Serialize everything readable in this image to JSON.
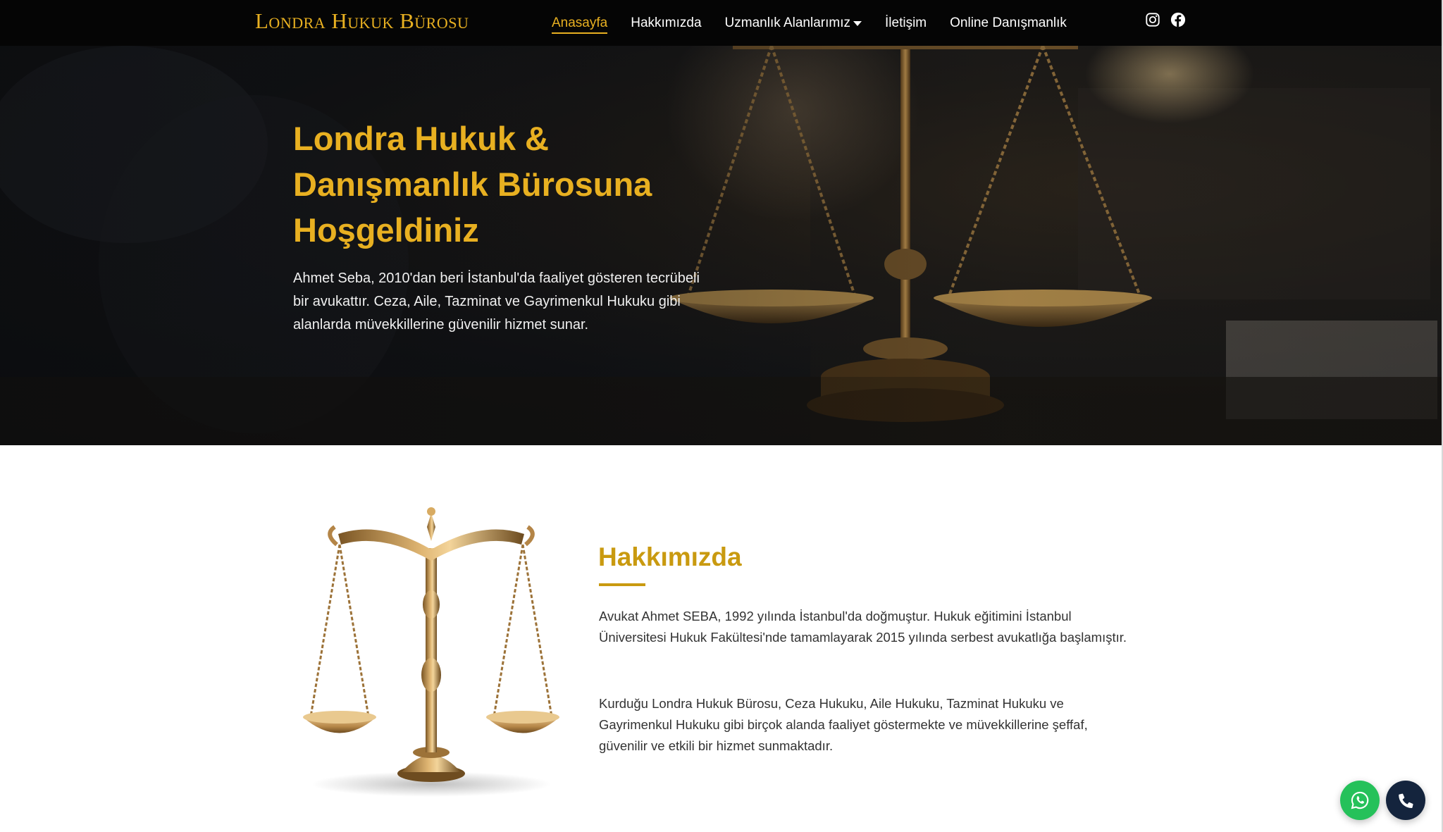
{
  "brand": {
    "name": "Londra Hukuk Bürosu"
  },
  "nav": {
    "items": [
      {
        "label": "Anasayfa",
        "active": true
      },
      {
        "label": "Hakkımızda",
        "active": false
      },
      {
        "label": "Uzmanlık Alanlarımız",
        "active": false,
        "has_dropdown": true
      },
      {
        "label": "İletişim",
        "active": false
      },
      {
        "label": "Online Danışmanlık",
        "active": false
      }
    ],
    "social": [
      "instagram-icon",
      "facebook-icon"
    ]
  },
  "hero": {
    "title": "Londra Hukuk & Danışmanlık Bürosuna Hoşgeldiniz",
    "text": "Ahmet Seba, 2010'dan beri İstanbul'da faaliyet gösteren tecrübeli bir avukattır. Ceza, Aile, Tazminat ve Gayrimenkul Hukuku gibi alanlarda müvekkillerine güvenilir hizmet sunar."
  },
  "about": {
    "title": "Hakkımızda",
    "paragraph1": "Avukat Ahmet SEBA, 1992 yılında İstanbul'da doğmuştur. Hukuk eğitimini İstanbul Üniversitesi Hukuk Fakültesi'nde tamamlayarak 2015 yılında serbest avukatlığa başlamıştır.",
    "paragraph2": "Kurduğu Londra Hukuk Bürosu, Ceza Hukuku, Aile Hukuku, Tazminat Hukuku ve Gayrimenkul Hukuku gibi birçok alanda faaliyet göstermekte ve müvekkillerine şeffaf, güvenilir ve etkili bir hizmet sunmaktadır."
  },
  "floating": [
    "whatsapp-icon",
    "phone-icon"
  ],
  "colors": {
    "accent": "#e8b021",
    "accent_dark": "#c99a10",
    "navbar_bg": "#050505",
    "whatsapp": "#25c15a",
    "phone": "#14243d"
  }
}
